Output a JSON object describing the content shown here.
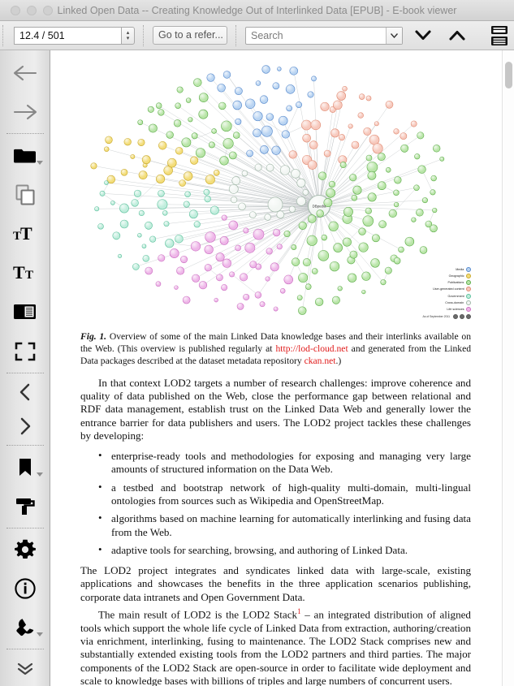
{
  "window": {
    "title": "Linked Open Data -- Creating Knowledge Out of Interlinked Data [EPUB] - E-book viewer",
    "buttons": [
      "close",
      "minimize",
      "zoom"
    ]
  },
  "toolbar": {
    "page_position_value": "12.4 / 501",
    "goto_reference_label": "Go to a refer...",
    "search_placeholder": "Search",
    "next_match_icon": "chevron-down-icon",
    "previous_match_icon": "chevron-up-icon",
    "toc_icon": "table-of-contents-icon",
    "spinner_up": "▴",
    "spinner_down": "▾",
    "search_dropdown_icon": "chevron-down-icon"
  },
  "sidebar": {
    "items": [
      {
        "name": "back-button",
        "icon": "arrow-left-icon",
        "has_dropdown": false
      },
      {
        "name": "forward-button",
        "icon": "arrow-right-icon",
        "has_dropdown": false
      },
      {
        "name": "open-book-button",
        "icon": "folder-icon",
        "has_dropdown": true
      },
      {
        "name": "copy-button",
        "icon": "copy-icon",
        "has_dropdown": false
      },
      {
        "name": "increase-font-button",
        "icon": "font-larger-icon",
        "has_dropdown": false
      },
      {
        "name": "decrease-font-button",
        "icon": "font-smaller-icon",
        "has_dropdown": false
      },
      {
        "name": "toggle-paged-mode-button",
        "icon": "paged-mode-icon",
        "has_dropdown": false
      },
      {
        "name": "fullscreen-button",
        "icon": "fullscreen-icon",
        "has_dropdown": false
      },
      {
        "name": "previous-page-button",
        "icon": "chevron-left-icon",
        "has_dropdown": false
      },
      {
        "name": "next-page-button",
        "icon": "chevron-right-icon",
        "has_dropdown": false
      },
      {
        "name": "bookmark-button",
        "icon": "bookmark-icon",
        "has_dropdown": true
      },
      {
        "name": "highlight-button",
        "icon": "paint-roller-icon",
        "has_dropdown": false
      },
      {
        "name": "preferences-button",
        "icon": "gear-icon",
        "has_dropdown": false
      },
      {
        "name": "about-button",
        "icon": "info-icon",
        "has_dropdown": false
      },
      {
        "name": "inspector-button",
        "icon": "wrench-icon",
        "has_dropdown": true
      },
      {
        "name": "more-tools-button",
        "icon": "double-chevron-down-icon",
        "has_dropdown": false
      }
    ]
  },
  "figure": {
    "caption_label": "Fig. 1.",
    "caption_part1": "Overview of some of the main Linked Data knowledge bases and their interlinks available on the Web. (This overview is published regularly at ",
    "caption_link1": "http://lod-cloud.net",
    "caption_part2": " and generated from the Linked Data packages described at the dataset metadata repository ",
    "caption_link2": "ckan.net",
    "caption_part3": ".)",
    "link_color": "#e01b1b",
    "legend": [
      {
        "label": "Media",
        "color": "#b9d4f2",
        "stroke": "#5588cc"
      },
      {
        "label": "Geographic",
        "color": "#f3dd7a",
        "stroke": "#c9a92c"
      },
      {
        "label": "Publications",
        "color": "#b9e5a8",
        "stroke": "#5ead4a"
      },
      {
        "label": "User-generated content",
        "color": "#f7c9bd",
        "stroke": "#e08a72"
      },
      {
        "label": "Government",
        "color": "#bfeddc",
        "stroke": "#5cc09c"
      },
      {
        "label": "Cross-domain",
        "color": "#f2f6f3",
        "stroke": "#9fb5a6"
      },
      {
        "label": "Life sciences",
        "color": "#eeb6e8",
        "stroke": "#cc6fc2"
      }
    ],
    "date_note": "As of September 2011",
    "cc_badges": [
      "cc-icon",
      "by-icon",
      "sa-icon"
    ],
    "center_node": "DBpedia"
  },
  "content": {
    "paragraph_1": "In that context LOD2 targets a number of research challenges: improve coherence and quality of data published on the Web, close the performance gap between relational and RDF data management, establish trust on the Linked Data Web and generally lower the entrance barrier for data publishers and users. The LOD2 project tackles these challenges by developing:",
    "bullets": [
      "enterprise-ready tools and methodologies for exposing and managing very large amounts of structured information on the Data Web.",
      "a testbed and bootstrap network of high-quality multi-domain, multi-lingual ontologies from sources such as Wikipedia and OpenStreetMap.",
      "algorithms based on machine learning for automatically interlinking and fusing data from the Web.",
      "adaptive tools for searching, browsing, and authoring of Linked Data."
    ],
    "paragraph_2": "The LOD2 project integrates and syndicates linked data with large-scale, existing applications and showcases the benefits in the three application scenarios publishing, corporate data intranets and Open Government Data.",
    "paragraph_3_before": "The main result of LOD2 is the LOD2 Stack",
    "paragraph_3_footnote": "1",
    "paragraph_3_after": " – an integrated distribution of aligned tools which support the whole life cycle of Linked Data from extraction, authoring/creation via enrichment, interlinking, fusing to maintenance. The LOD2 Stack comprises new and substantially extended existing tools from the LOD2 partners and third parties. The major components of the LOD2 Stack are open-source in order to facilitate wide deployment and scale to knowledge bases with billions of triples and large numbers of concurrent users."
  },
  "scrollbar": {
    "name": "vertical-scrollbar"
  }
}
